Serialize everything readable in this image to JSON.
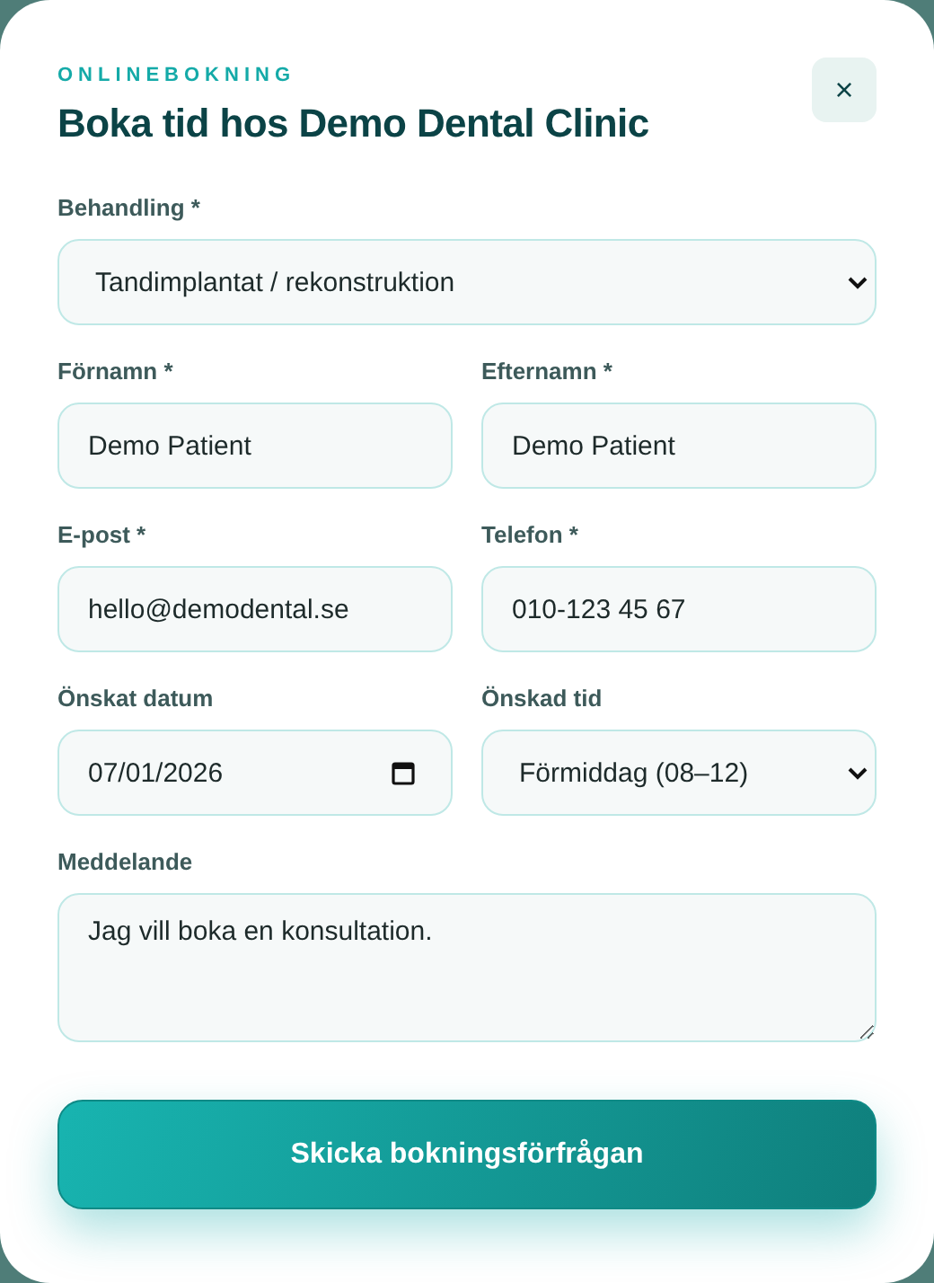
{
  "header": {
    "eyebrow": "ONLINEBOKNING",
    "title": "Boka tid hos Demo Dental Clinic",
    "close": "×"
  },
  "rows": [
    [
      {
        "kind": "select",
        "label": "Behandling *",
        "value": "Tandimplantat / rekonstruktion"
      }
    ],
    [
      {
        "kind": "text",
        "label": "Förnamn *",
        "value": "Demo Patient"
      },
      {
        "kind": "text",
        "label": "Efternamn *",
        "value": "Demo Patient"
      }
    ],
    [
      {
        "kind": "text",
        "label": "E-post *",
        "value": "hello@demodental.se"
      },
      {
        "kind": "text",
        "label": "Telefon *",
        "value": "010-123 45 67"
      }
    ],
    [
      {
        "kind": "date",
        "label": "Önskat datum",
        "value": "07/01/2026"
      },
      {
        "kind": "select",
        "label": "Önskad tid",
        "value": "Förmiddag (08–12)"
      }
    ],
    [
      {
        "kind": "textarea",
        "label": "Meddelande",
        "value": "Jag vill boka en konsultation."
      }
    ]
  ],
  "submit": "Skicka bokningsförfrågan"
}
